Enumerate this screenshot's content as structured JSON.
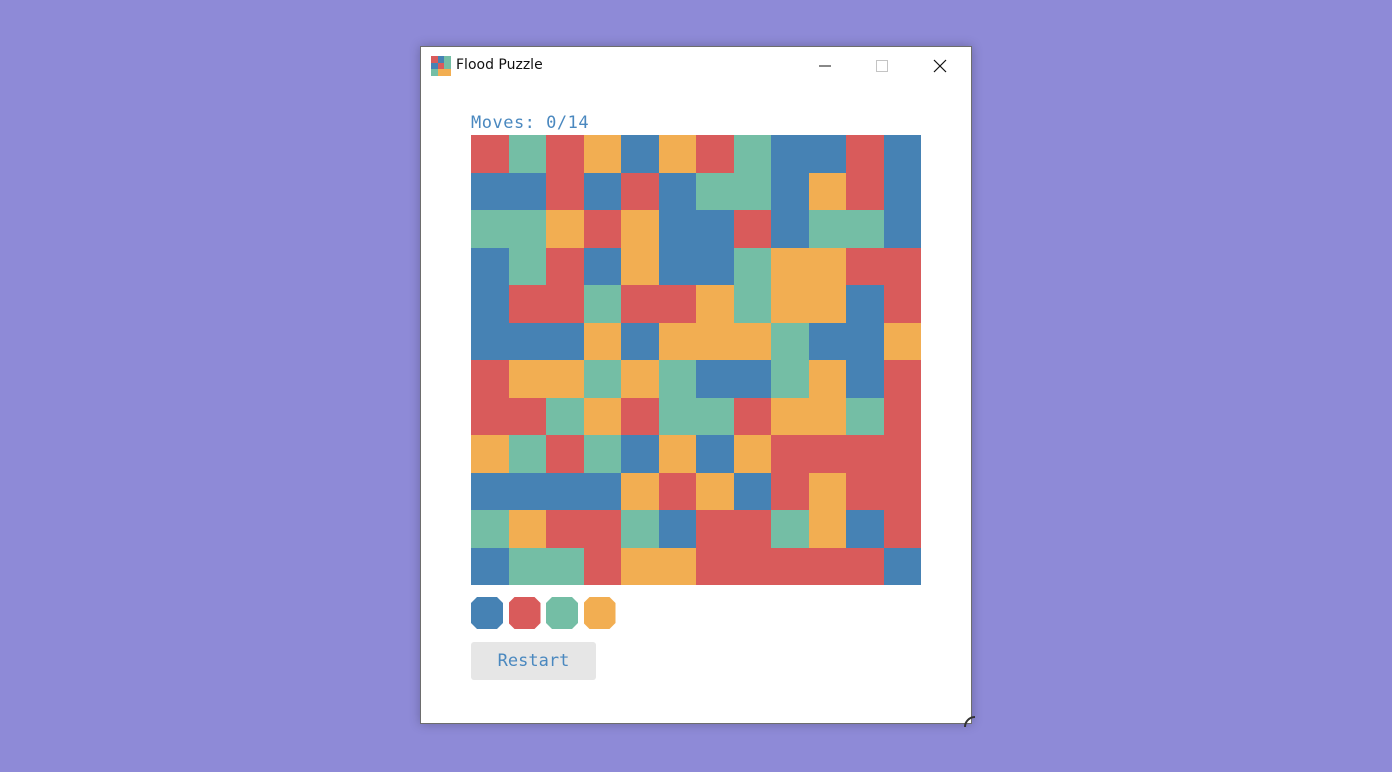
{
  "window": {
    "title": "Flood Puzzle"
  },
  "status": {
    "moves_text": "Moves: 0/14"
  },
  "colors": {
    "blue": "#4682b4",
    "red": "#d95b5b",
    "teal": "#74bea5",
    "orange": "#f2ae52"
  },
  "board": [
    [
      "R",
      "T",
      "R",
      "O",
      "B",
      "O",
      "R",
      "T",
      "B",
      "B",
      "R",
      "B"
    ],
    [
      "B",
      "B",
      "R",
      "B",
      "R",
      "B",
      "T",
      "T",
      "B",
      "O",
      "R",
      "B"
    ],
    [
      "T",
      "T",
      "O",
      "R",
      "O",
      "B",
      "B",
      "R",
      "B",
      "T",
      "T",
      "B"
    ],
    [
      "B",
      "T",
      "R",
      "B",
      "O",
      "B",
      "B",
      "T",
      "O",
      "O",
      "R",
      "R"
    ],
    [
      "B",
      "R",
      "R",
      "T",
      "R",
      "R",
      "O",
      "T",
      "O",
      "O",
      "B",
      "R"
    ],
    [
      "B",
      "B",
      "B",
      "O",
      "B",
      "O",
      "O",
      "O",
      "T",
      "B",
      "B",
      "O"
    ],
    [
      "R",
      "O",
      "O",
      "T",
      "O",
      "T",
      "B",
      "B",
      "T",
      "O",
      "B",
      "R"
    ],
    [
      "R",
      "R",
      "T",
      "O",
      "R",
      "T",
      "T",
      "R",
      "O",
      "O",
      "T",
      "R"
    ],
    [
      "O",
      "T",
      "R",
      "T",
      "B",
      "O",
      "B",
      "O",
      "R",
      "R",
      "R",
      "R"
    ],
    [
      "B",
      "B",
      "B",
      "B",
      "O",
      "R",
      "O",
      "B",
      "R",
      "O",
      "R",
      "R"
    ],
    [
      "T",
      "O",
      "R",
      "R",
      "T",
      "B",
      "R",
      "R",
      "T",
      "O",
      "B",
      "R"
    ],
    [
      "B",
      "T",
      "T",
      "R",
      "O",
      "O",
      "R",
      "R",
      "R",
      "R",
      "R",
      "B"
    ]
  ],
  "palette": [
    "blue",
    "red",
    "teal",
    "orange"
  ],
  "controls": {
    "restart_label": "Restart"
  },
  "icons": {
    "app": "flood-puzzle-app-icon",
    "minimize": "minimize-icon",
    "maximize": "maximize-icon",
    "close": "close-icon"
  }
}
